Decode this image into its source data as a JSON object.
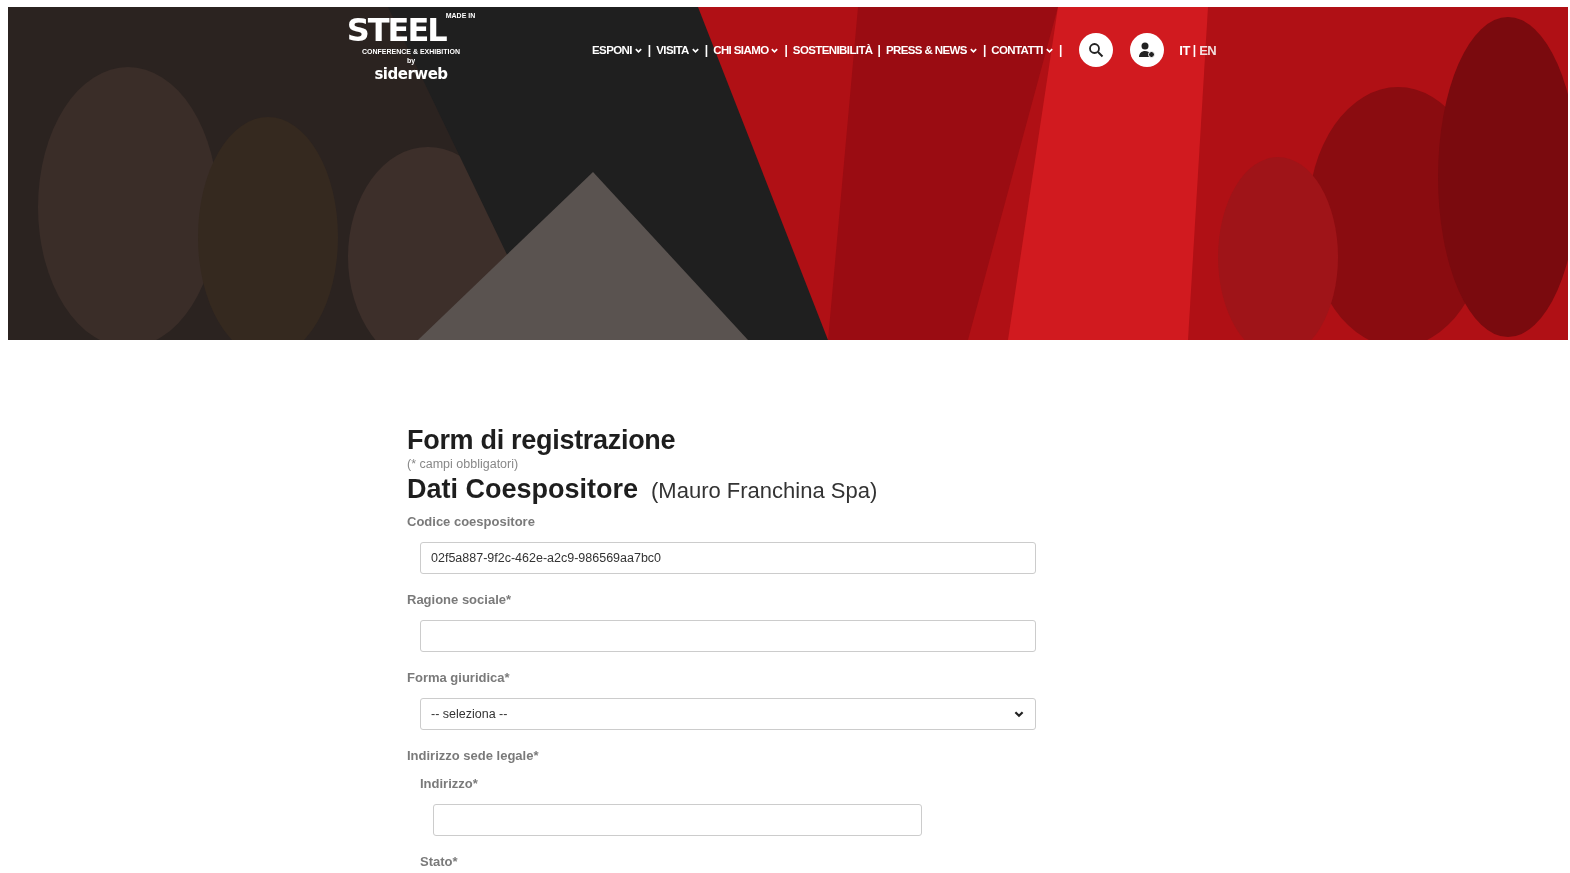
{
  "header": {
    "logo": {
      "made_in": "MADE IN",
      "brand": "STEEL",
      "tagline": "CONFERENCE & EXHIBITION",
      "by": "by",
      "partner": "siderweb"
    },
    "nav": [
      {
        "label": "ESPONI",
        "dropdown": true,
        "separator": "|"
      },
      {
        "label": "VISITA",
        "dropdown": true,
        "separator": "|"
      },
      {
        "label": "CHI SIAMO",
        "dropdown": true,
        "separator": "|"
      },
      {
        "label": "SOSTENIBILITÀ",
        "dropdown": false,
        "separator": "|"
      },
      {
        "label": "PRESS & NEWS",
        "dropdown": true,
        "separator": "|"
      },
      {
        "label": "CONTATTI",
        "dropdown": true,
        "separator": "|"
      }
    ],
    "languages": [
      {
        "label": "IT",
        "selected": true,
        "separator": "|"
      },
      {
        "label": "EN",
        "selected": false
      }
    ]
  },
  "form": {
    "title": "Form di registrazione",
    "note": "(* campi obbligatori)",
    "section_title": "Dati Coespositore",
    "section_subtitle": "(Mauro Franchina Spa)",
    "fields": [
      {
        "kind": "text",
        "label": "Codice coespositore",
        "value": "02f5a887-9f2c-462e-a2c9-986569aa7bc0"
      },
      {
        "kind": "text",
        "label": "Ragione sociale*"
      },
      {
        "kind": "select",
        "label": "Forma giuridica*",
        "value": "-- seleziona --"
      },
      {
        "kind": "group",
        "label": "Indirizzo sede legale*",
        "children": [
          {
            "kind": "text",
            "label": "Indirizzo*"
          },
          {
            "kind": "label",
            "label": "Stato*"
          }
        ]
      }
    ]
  }
}
